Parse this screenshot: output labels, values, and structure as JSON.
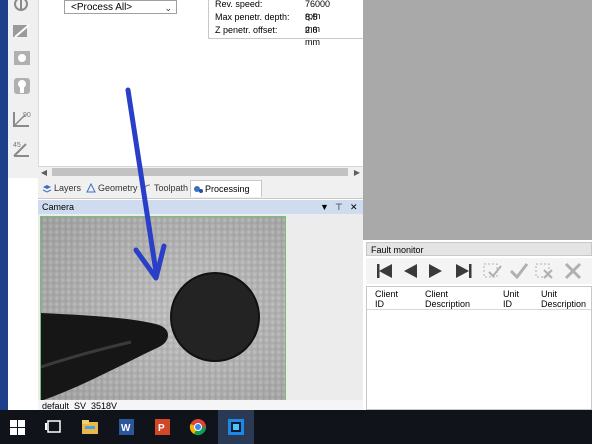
{
  "process": {
    "dropdown_value": "<Process All>"
  },
  "parameters": [
    {
      "label": "Rev. speed:",
      "value": "76000 rpm"
    },
    {
      "label": "Max penetr. depth:",
      "value": "8.5 mm"
    },
    {
      "label": "Z penetr. offset:",
      "value": "2.6 mm"
    }
  ],
  "tabs": [
    {
      "label": "Layers",
      "icon": "layers-icon"
    },
    {
      "label": "Geometry",
      "icon": "geometry-icon"
    },
    {
      "label": "Toolpath",
      "icon": "toolpath-icon"
    },
    {
      "label": "Processing",
      "icon": "processing-icon",
      "active": true
    }
  ],
  "camera": {
    "title": "Camera",
    "pin": "↓",
    "pin2": "↕",
    "close": "✖",
    "status": "default_SV_3518V"
  },
  "fault_monitor": {
    "title": "Fault monitor",
    "columns": [
      {
        "line1": "Client",
        "line2": "ID"
      },
      {
        "line1": "Client",
        "line2": "Description"
      },
      {
        "line1": "Unit",
        "line2": "ID"
      },
      {
        "line1": "Unit",
        "line2": "Description"
      }
    ]
  },
  "taskbar": {
    "apps": [
      "windows-start",
      "task-view",
      "file-explorer",
      "word",
      "powerpoint",
      "chrome",
      "active-app"
    ]
  },
  "colors": {
    "accent_blue": "#2a3fc7",
    "taskbar": "#10131a",
    "panel_header": "#cfdcef"
  }
}
